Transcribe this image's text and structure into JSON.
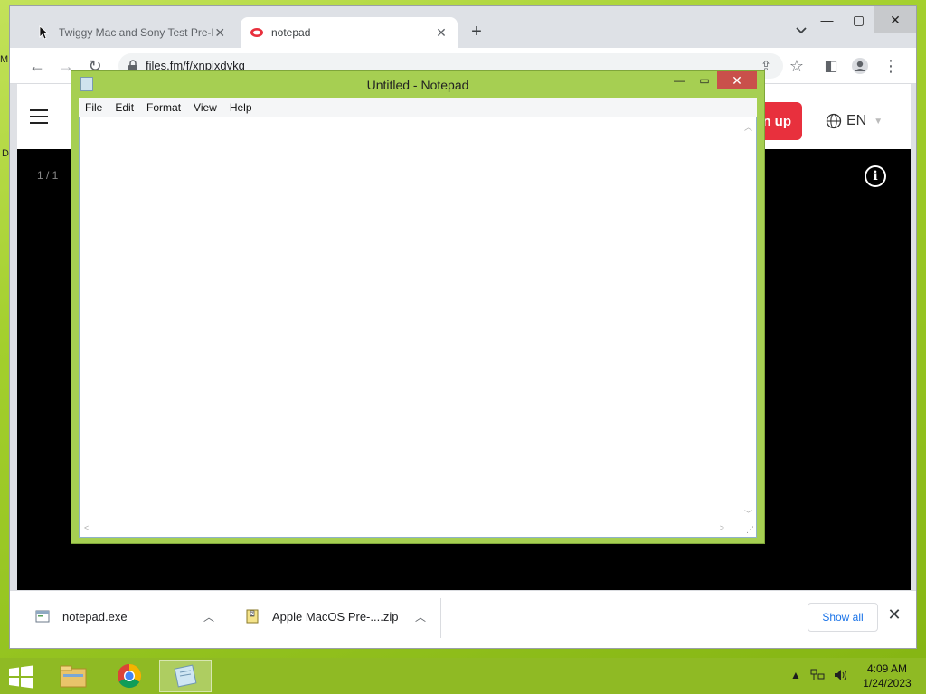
{
  "desktop": {
    "edge_text_1": "M",
    "edge_text_2": "D"
  },
  "browser": {
    "tabs": [
      {
        "title": "Twiggy Mac and Sony Test Pre-R",
        "active": false
      },
      {
        "title": "notepad",
        "active": true
      }
    ],
    "url": "files.fm/f/xnpjxdykq",
    "page": {
      "signup_label": "n up",
      "language": "EN",
      "page_counter": "1 / 1",
      "info_label": "i"
    },
    "downloads": {
      "items": [
        {
          "name": "notepad.exe",
          "icon": "exe-file-icon"
        },
        {
          "name": "Apple MacOS Pre-....zip",
          "icon": "zip-file-icon"
        }
      ],
      "show_all_label": "Show all"
    }
  },
  "notepad": {
    "title": "Untitled - Notepad",
    "menu": [
      "File",
      "Edit",
      "Format",
      "View",
      "Help"
    ],
    "content": ""
  },
  "taskbar": {
    "apps": [
      "file-explorer-icon",
      "chrome-icon",
      "notepad-icon"
    ],
    "time": "4:09 AM",
    "date": "1/24/2023"
  },
  "colors": {
    "wallpaper": "#a3cf2d",
    "notepad_frame": "#a6cf52",
    "signup_red": "#e8303d",
    "link_blue": "#1a73e8"
  }
}
